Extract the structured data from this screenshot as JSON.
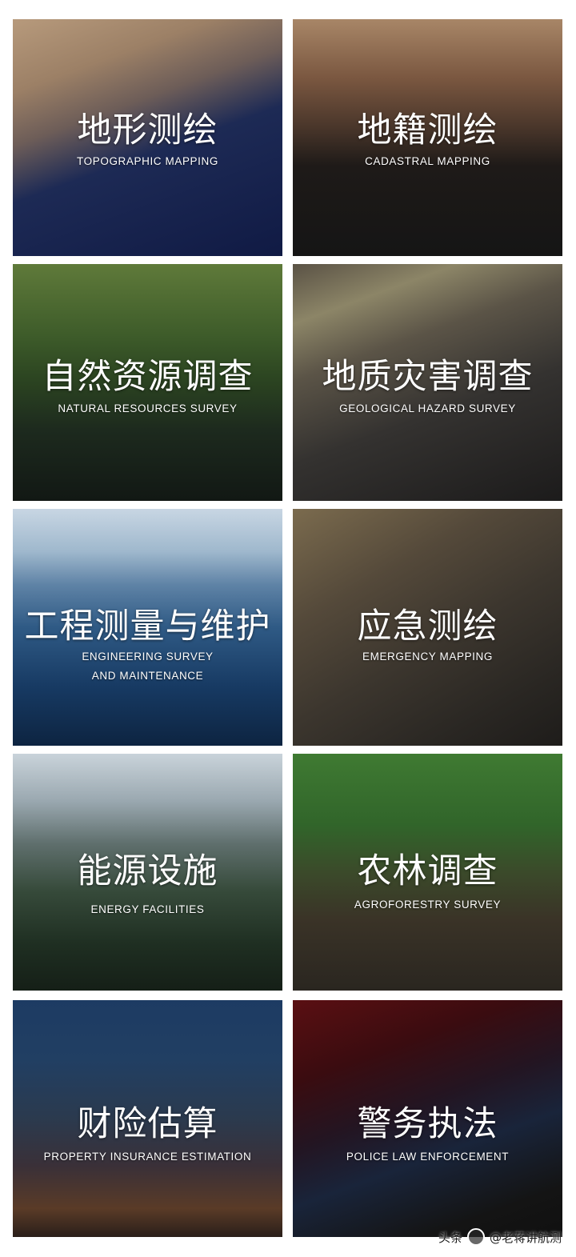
{
  "tiles": [
    {
      "title": "地形测绘",
      "subtitle": "TOPOGRAPHIC MAPPING"
    },
    {
      "title": "地籍测绘",
      "subtitle": "CADASTRAL MAPPING"
    },
    {
      "title": "自然资源调查",
      "subtitle": "NATURAL RESOURCES SURVEY"
    },
    {
      "title": "地质灾害调查",
      "subtitle": "GEOLOGICAL HAZARD SURVEY"
    },
    {
      "title": "工程测量与维护",
      "subtitle": "ENGINEERING SURVEY",
      "subtitle2": "AND MAINTENANCE"
    },
    {
      "title": "应急测绘",
      "subtitle": "EMERGENCY MAPPING"
    },
    {
      "title": "能源设施",
      "subtitle": "ENERGY FACILITIES"
    },
    {
      "title": "农林调查",
      "subtitle": "AGROFORESTRY SURVEY"
    },
    {
      "title": "财险估算",
      "subtitle": "PROPERTY INSURANCE ESTIMATION"
    },
    {
      "title": "警务执法",
      "subtitle": "POLICE LAW ENFORCEMENT"
    }
  ],
  "watermark": {
    "text": "老蒋讲航测"
  },
  "footer": {
    "prefix": "头条",
    "handle": "@老蒋讲航测"
  }
}
